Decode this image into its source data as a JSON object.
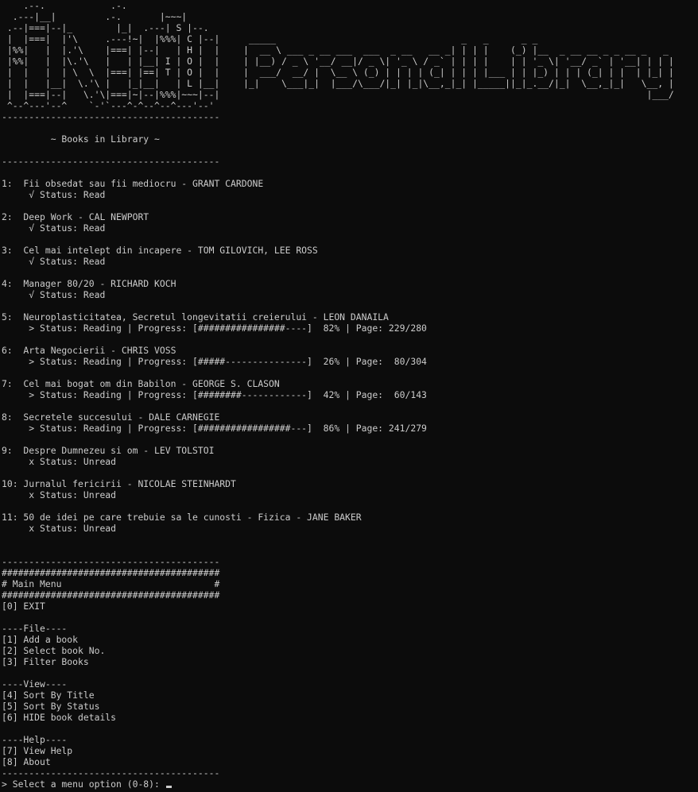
{
  "ascii_school_logo": [
    "    .--.            .-.",
    "  .---|__|         .-.       |~~~|",
    " .--|===|--|_        |_|  .---| S |--.",
    " |  |===|  |'\\     .---!~|  |%%%| C |--|",
    " |%%|   |  |.'\\    |===| |--|   | H |  |",
    " |%%|   |  |\\.'\\   |   | |__| I | O |  |",
    " |  |   |  | \\  \\  |===| |==| T | O |  |",
    " |  |   |__|  \\.'\\ |   |_|__|   | L |__|",
    " |  |===|--|   \\.'\\|===|~|--|%%%|~~~|--|",
    " ^--^---'--^    `-'`---^-^--^--^---'--'"
  ],
  "ascii_title": [
    " _____                                  _   _      _ _                          ",
    "|  __ \\ ___ _ __ ___  ___  _ __   __ _| | | |    (_) |__  _ __ __ _ _ __ _   _ ",
    "| |__) / _ \\ '__/ __|/ _ \\| '_ \\ / _` | | | |    | | '_ \\| '__/ _` | '__| | | |",
    "|  ___/  __/ |  \\__ \\ (_) | | | | (_| | | | |___ | | |_) | | | (_| | |  | |_| |",
    "|_|    \\___|_|  |___/\\___/|_| |_|\\__,_|_| |_____||_|_.__/|_|  \\__,_|_|   \\__, |",
    "                                                                          |___/ "
  ],
  "separator": "----------------------------------------",
  "books_heading": "         ~ Books in Library ~",
  "books": [
    {
      "title_line": "1:  Fii obsedat sau fii mediocru - GRANT CARDONE",
      "status_line": "     √ Status: Read"
    },
    {
      "title_line": "2:  Deep Work - CAL NEWPORT",
      "status_line": "     √ Status: Read"
    },
    {
      "title_line": "3:  Cel mai intelept din incapere - TOM GILOVICH, LEE ROSS",
      "status_line": "     √ Status: Read"
    },
    {
      "title_line": "4:  Manager 80/20 - RICHARD KOCH",
      "status_line": "     √ Status: Read"
    },
    {
      "title_line": "5:  Neuroplasticitatea, Secretul longevitatii creierului - LEON DANAILA",
      "status_line": "     > Status: Reading | Progress: [################----]  82% | Page: 229/280"
    },
    {
      "title_line": "6:  Arta Negocierii - CHRIS VOSS",
      "status_line": "     > Status: Reading | Progress: [#####---------------]  26% | Page:  80/304"
    },
    {
      "title_line": "7:  Cel mai bogat om din Babilon - GEORGE S. CLASON",
      "status_line": "     > Status: Reading | Progress: [########------------]  42% | Page:  60/143"
    },
    {
      "title_line": "8:  Secretele succesului - DALE CARNEGIE",
      "status_line": "     > Status: Reading | Progress: [#################---]  86% | Page: 241/279"
    },
    {
      "title_line": "9:  Despre Dumnezeu si om - LEV TOLSTOI",
      "status_line": "     x Status: Unread"
    },
    {
      "title_line": "10: Jurnalul fericirii - NICOLAE STEINHARDT",
      "status_line": "     x Status: Unread"
    },
    {
      "title_line": "11: 50 de idei pe care trebuie sa le cunosti - Fizica - JANE BAKER",
      "status_line": "     x Status: Unread"
    }
  ],
  "menu": {
    "hash_line": "########################################",
    "title_line": "# Main Menu                            #",
    "exit": "[0] EXIT",
    "file_header": "----File----",
    "file_items": [
      "[1] Add a book",
      "[2] Select book No.",
      "[3] Filter Books"
    ],
    "view_header": "----View----",
    "view_items": [
      "[4] Sort By Title",
      "[5] Sort By Status",
      "[6] HIDE book details"
    ],
    "help_header": "----Help----",
    "help_items": [
      "[7] View Help",
      "[8] About"
    ]
  },
  "prompt": "> Select a menu option (0-8): "
}
